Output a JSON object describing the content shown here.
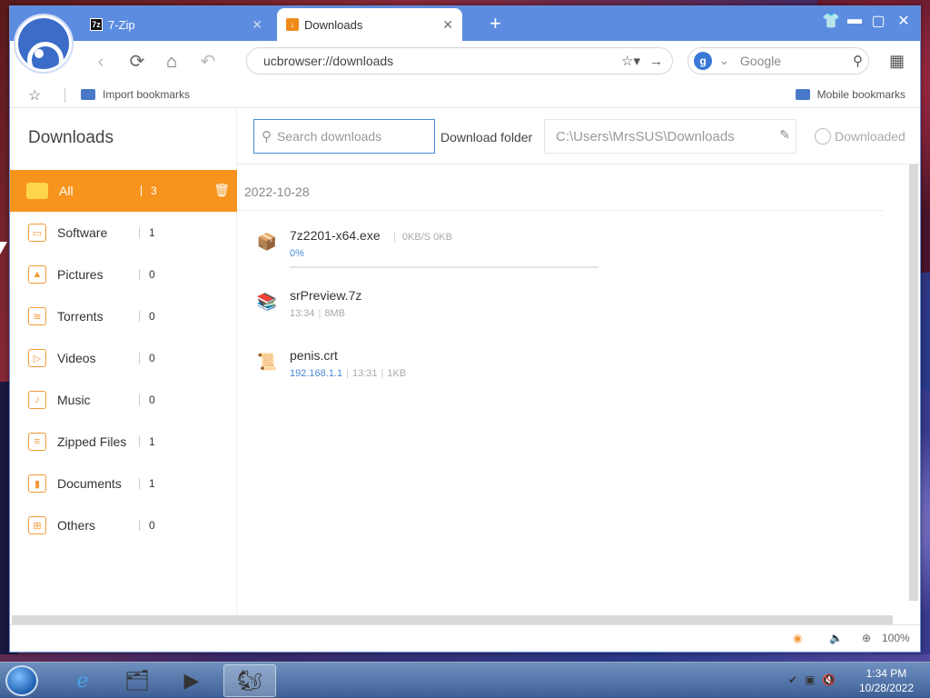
{
  "tabs": [
    {
      "label": "7-Zip",
      "icon": "7z"
    },
    {
      "label": "Downloads",
      "icon": "download-icon"
    }
  ],
  "address": "ucbrowser://downloads",
  "search_engine": {
    "placeholder": "Google",
    "icon": "g"
  },
  "bookmarks": {
    "import": "Import bookmarks",
    "mobile": "Mobile bookmarks"
  },
  "downloads": {
    "title": "Downloads",
    "search_placeholder": "Search downloads",
    "folder_label": "Download folder",
    "folder_path": "C:\\Users\\MrsSUS\\Downloads",
    "downloaded_label": "Downloaded"
  },
  "categories": [
    {
      "label": "All",
      "count": "3",
      "icon": "folder-icon"
    },
    {
      "label": "Software",
      "count": "1",
      "icon": "software-icon"
    },
    {
      "label": "Pictures",
      "count": "0",
      "icon": "picture-icon"
    },
    {
      "label": "Torrents",
      "count": "0",
      "icon": "torrent-icon"
    },
    {
      "label": "Videos",
      "count": "0",
      "icon": "video-icon"
    },
    {
      "label": "Music",
      "count": "0",
      "icon": "music-icon"
    },
    {
      "label": "Zipped Files",
      "count": "1",
      "icon": "zip-icon"
    },
    {
      "label": "Documents",
      "count": "1",
      "icon": "document-icon"
    },
    {
      "label": "Others",
      "count": "0",
      "icon": "others-icon"
    }
  ],
  "date_group": "2022-10-28",
  "files": [
    {
      "name": "7z2201-x64.exe",
      "progress": "0%",
      "speed": "0KB/S",
      "size": "0KB",
      "progress_fraction": 0
    },
    {
      "name": "srPreview.7z",
      "time": "13:34",
      "size": "8MB"
    },
    {
      "name": "penis.crt",
      "source": "192.168.1.1",
      "time": "13:31",
      "size": "1KB"
    }
  ],
  "status": {
    "zoom": "100%"
  },
  "taskbar": {
    "time": "1:34 PM",
    "date": "10/28/2022"
  },
  "colors": {
    "accent": "#f7941d",
    "titlebar": "#5c8ce0",
    "link": "#4a8ad8"
  }
}
